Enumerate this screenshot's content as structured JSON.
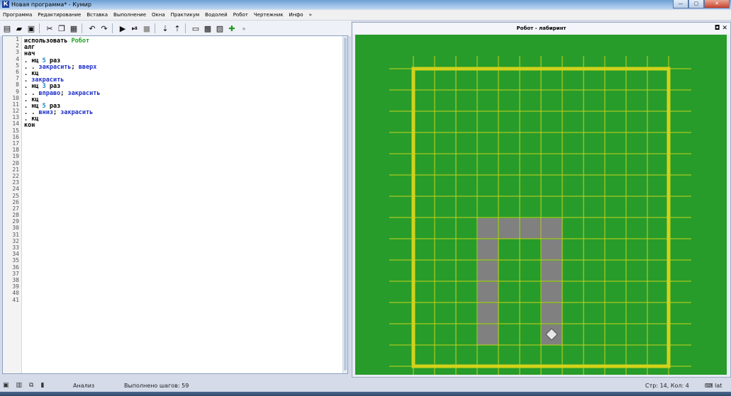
{
  "window": {
    "title": "Новая программа* - Кумир",
    "app_icon": "К"
  },
  "menu": [
    "Программа",
    "Редактирование",
    "Вставка",
    "Выполнение",
    "Окна",
    "Практикум",
    "Водолей",
    "Робот",
    "Чертежник",
    "Инфо",
    "»"
  ],
  "toolbar": {
    "icons": [
      "new-file-icon",
      "open-folder-icon",
      "save-icon",
      "cut-icon",
      "copy-icon",
      "paste-icon",
      "undo-icon",
      "redo-icon",
      "run-icon",
      "step-run-icon",
      "stop-icon",
      "step-into-icon",
      "step-out-icon",
      "window1-icon",
      "window2-icon",
      "window3-icon",
      "robot-window-icon"
    ],
    "more": "»"
  },
  "editor": {
    "line_numbers": [
      "1",
      "2",
      "3",
      "4",
      "5",
      "6",
      "7",
      "8",
      "9",
      "10",
      "11",
      "12",
      "13",
      "14",
      "15",
      "16",
      "17",
      "18",
      "19",
      "20",
      "21",
      "22",
      "23",
      "24",
      "25",
      "26",
      "27",
      "28",
      "29",
      "30",
      "31",
      "32",
      "33",
      "34",
      "35",
      "36",
      "37",
      "38",
      "39",
      "40",
      "41"
    ],
    "lines": [
      [
        {
          "t": "использовать ",
          "c": "kw"
        },
        {
          "t": "Робот",
          "c": "green"
        }
      ],
      [
        {
          "t": "алг",
          "c": "kw"
        }
      ],
      [
        {
          "t": "нач",
          "c": "kw"
        }
      ],
      [
        {
          "t": ". нц ",
          "c": "kw"
        },
        {
          "t": "5",
          "c": "num"
        },
        {
          "t": " раз",
          "c": "kw"
        }
      ],
      [
        {
          "t": ". . ",
          "c": "kw"
        },
        {
          "t": "закрасить",
          "c": "blue"
        },
        {
          "t": "; ",
          "c": "kw"
        },
        {
          "t": "вверх",
          "c": "blue"
        }
      ],
      [
        {
          "t": ". кц",
          "c": "kw"
        }
      ],
      [
        {
          "t": ". ",
          "c": "kw"
        },
        {
          "t": "закрасить",
          "c": "blue"
        }
      ],
      [
        {
          "t": ". нц ",
          "c": "kw"
        },
        {
          "t": "3",
          "c": "num"
        },
        {
          "t": " раз",
          "c": "kw"
        }
      ],
      [
        {
          "t": ". . ",
          "c": "kw"
        },
        {
          "t": "вправо",
          "c": "blue"
        },
        {
          "t": "; ",
          "c": "kw"
        },
        {
          "t": "закрасить",
          "c": "blue"
        }
      ],
      [
        {
          "t": ". кц",
          "c": "kw"
        }
      ],
      [
        {
          "t": ". нц ",
          "c": "kw"
        },
        {
          "t": "5",
          "c": "num"
        },
        {
          "t": " раз",
          "c": "kw"
        }
      ],
      [
        {
          "t": ". . ",
          "c": "kw"
        },
        {
          "t": "вниз",
          "c": "blue"
        },
        {
          "t": "; ",
          "c": "kw"
        },
        {
          "t": "закрасить",
          "c": "blue"
        }
      ],
      [
        {
          "t": ". кц",
          "c": "kw"
        }
      ],
      [
        {
          "t": "кон",
          "c": "kw"
        }
      ]
    ]
  },
  "robot_panel": {
    "title": "Робот - лабиринт",
    "controls": "◘ ✕",
    "field": {
      "cols": 12,
      "rows": 14,
      "painted": [
        [
          3,
          7
        ],
        [
          4,
          7
        ],
        [
          5,
          7
        ],
        [
          6,
          7
        ],
        [
          3,
          8
        ],
        [
          3,
          9
        ],
        [
          3,
          10
        ],
        [
          3,
          11
        ],
        [
          3,
          12
        ],
        [
          6,
          8
        ],
        [
          6,
          9
        ],
        [
          6,
          10
        ],
        [
          6,
          11
        ],
        [
          6,
          12
        ]
      ],
      "robot": [
        6,
        12
      ],
      "colors": {
        "bg": "#279c2a",
        "grid": "#c8d21e",
        "wall": "#d2d21b",
        "paint": "#808080",
        "robot": "#e8e8e8"
      }
    }
  },
  "status": {
    "analysis": "Анализ",
    "steps": "Выполнено шагов: 59",
    "position": "Стр: 14, Кол: 4",
    "lang": "lat"
  }
}
